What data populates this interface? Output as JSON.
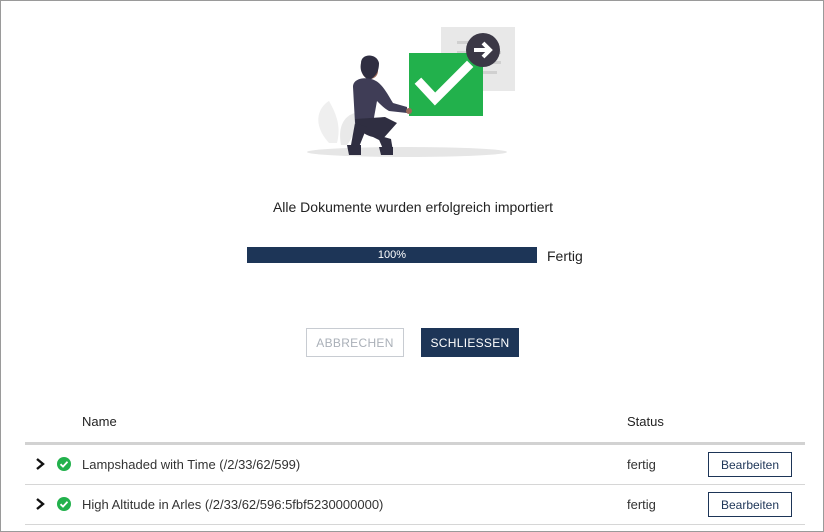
{
  "dialog": {
    "message": "Alle Dokumente wurden erfolgreich importiert",
    "progress": {
      "fraction": 1.0,
      "label": "100%",
      "status": "Fertig"
    },
    "buttons": {
      "cancel": "ABBRECHEN",
      "close": "SCHLIESSEN"
    }
  },
  "table": {
    "headers": {
      "name": "Name",
      "status": "Status"
    },
    "rows": [
      {
        "name": "Lampshaded with Time (/2/33/62/599)",
        "status": "fertig",
        "action": "Bearbeiten"
      },
      {
        "name": "High Altitude in Arles (/2/33/62/596:5fbf5230000000)",
        "status": "fertig",
        "action": "Bearbeiten"
      }
    ]
  },
  "colors": {
    "accent": "#1d3557",
    "success": "#22b14c"
  },
  "icons": {
    "illustration": "person-with-check-document-illustration",
    "row_expand": "chevron-right-icon",
    "row_status": "check-circle-icon"
  }
}
